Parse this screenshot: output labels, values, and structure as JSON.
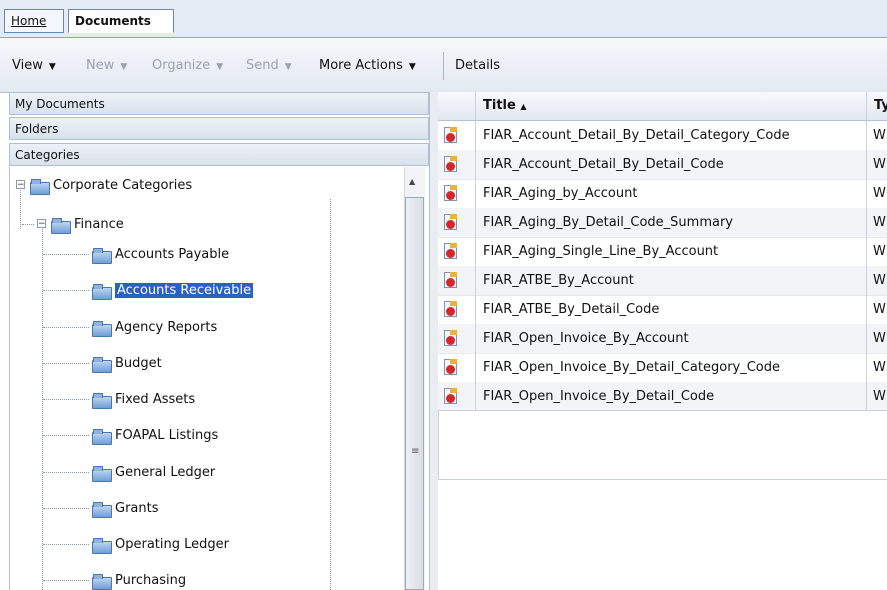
{
  "tabs": {
    "home": "Home",
    "documents": "Documents"
  },
  "toolbar": {
    "view": "View",
    "new": "New",
    "organize": "Organize",
    "send": "Send",
    "more_actions": "More Actions",
    "details": "Details"
  },
  "left_panel": {
    "my_documents": "My Documents",
    "folders": "Folders",
    "categories": "Categories"
  },
  "tree": {
    "root": "Corporate Categories",
    "finance": "Finance",
    "items": [
      "Accounts Payable",
      "Accounts Receivable",
      "Agency Reports",
      "Budget",
      "Fixed Assets",
      "FOAPAL Listings",
      "General Ledger",
      "Grants",
      "Operating Ledger",
      "Purchasing"
    ],
    "selected": "Accounts Receivable"
  },
  "grid": {
    "columns": {
      "title": "Title",
      "sort_indicator": "▲",
      "type": "Ty"
    },
    "rows": [
      {
        "title": "FIAR_Account_Detail_By_Detail_Category_Code",
        "type": "W"
      },
      {
        "title": "FIAR_Account_Detail_By_Detail_Code",
        "type": "W"
      },
      {
        "title": "FIAR_Aging_by_Account",
        "type": "W"
      },
      {
        "title": "FIAR_Aging_By_Detail_Code_Summary",
        "type": "W"
      },
      {
        "title": "FIAR_Aging_Single_Line_By_Account",
        "type": "W"
      },
      {
        "title": "FIAR_ATBE_By_Account",
        "type": "W"
      },
      {
        "title": "FIAR_ATBE_By_Detail_Code",
        "type": "W"
      },
      {
        "title": "FIAR_Open_Invoice_By_Account",
        "type": "W"
      },
      {
        "title": "FIAR_Open_Invoice_By_Detail_Category_Code",
        "type": "W"
      },
      {
        "title": "FIAR_Open_Invoice_By_Detail_Code",
        "type": "W"
      }
    ]
  },
  "colors": {
    "accent": "#2a62c4",
    "header_bg": "#e4ebf5",
    "doc_icon": "#d4262b"
  },
  "icons": {
    "folder": "folder-icon",
    "document": "report-document-icon",
    "expand": "collapse-icon"
  }
}
